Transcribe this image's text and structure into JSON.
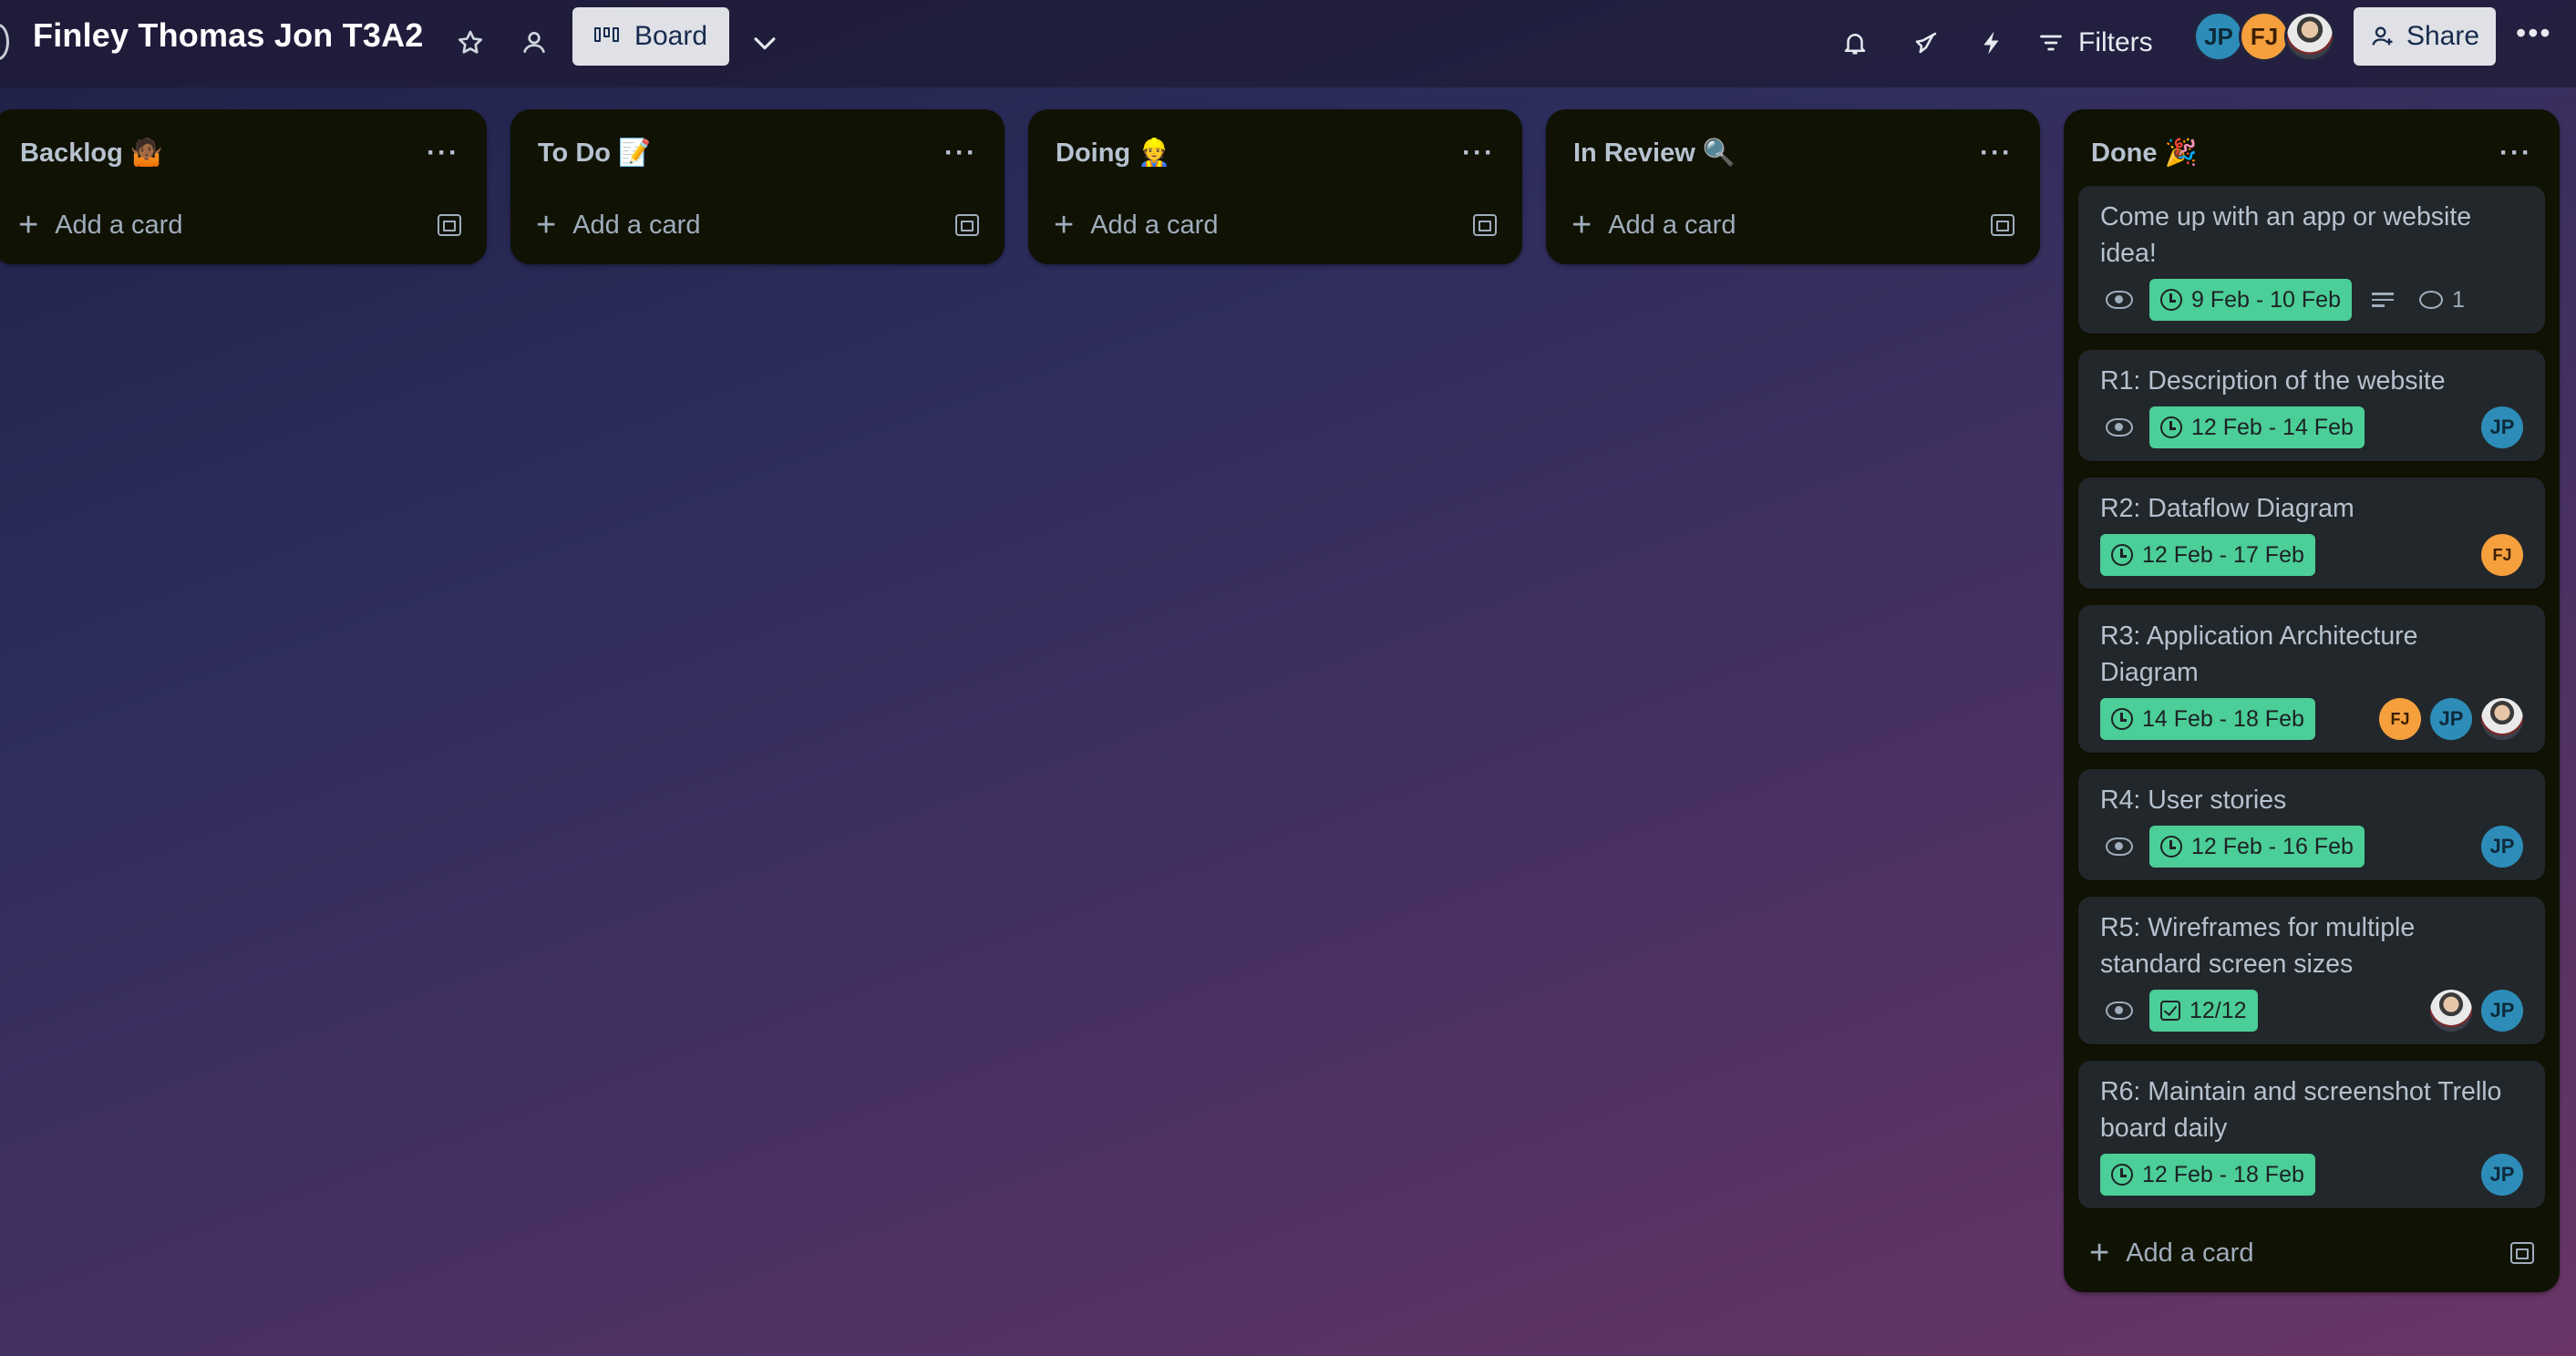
{
  "header": {
    "title": "Finley Thomas Jon T3A2",
    "view_label": "Board",
    "filters_label": "Filters",
    "share_label": "Share",
    "members": [
      {
        "initials": "JP",
        "color": "#2d8db8"
      },
      {
        "initials": "FJ",
        "color": "#f5a03d"
      },
      {
        "initials": "",
        "photo": true
      }
    ]
  },
  "lists": [
    {
      "title": "Backlog 🤷🏾",
      "add_label": "Add a card",
      "cards": []
    },
    {
      "title": "To Do 📝",
      "add_label": "Add a card",
      "cards": []
    },
    {
      "title": "Doing 👷",
      "add_label": "Add a card",
      "cards": []
    },
    {
      "title": "In Review 🔍",
      "add_label": "Add a card",
      "cards": []
    },
    {
      "title": "Done 🎉",
      "add_label": "Add a card",
      "cards": [
        {
          "title": "Come up with an app or website idea!",
          "watch": true,
          "date": "9 Feb - 10 Feb",
          "description": true,
          "comments": "1",
          "members": []
        },
        {
          "title": "R1: Description of the website",
          "watch": true,
          "date": "12 Feb - 14 Feb",
          "members": [
            "JP"
          ]
        },
        {
          "title": "R2: Dataflow Diagram",
          "watch": false,
          "date": "12 Feb - 17 Feb",
          "members": [
            "FJ"
          ]
        },
        {
          "title": "R3: Application Architecture Diagram",
          "watch": false,
          "date": "14 Feb - 18 Feb",
          "members": [
            "FJ",
            "JP",
            "photo"
          ]
        },
        {
          "title": "R4: User stories",
          "watch": true,
          "date": "12 Feb - 16 Feb",
          "members": [
            "JP"
          ]
        },
        {
          "title": "R5: Wireframes for multiple standard screen sizes",
          "watch": true,
          "checklist": "12/12",
          "members": [
            "photo",
            "JP"
          ]
        },
        {
          "title": "R6: Maintain and screenshot Trello board daily",
          "watch": false,
          "date": "12 Feb - 18 Feb",
          "members": [
            "JP"
          ]
        }
      ]
    }
  ],
  "colors": {
    "list_bg": "#101204",
    "card_bg": "#22272b",
    "date_badge": "#4bce97",
    "button_bg": "#dfe1e6"
  }
}
